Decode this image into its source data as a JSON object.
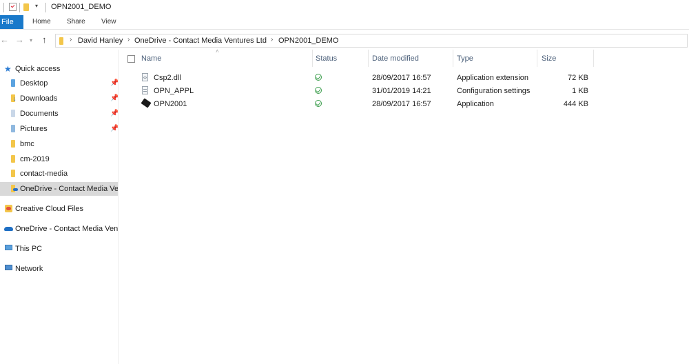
{
  "window": {
    "title": "OPN2001_DEMO"
  },
  "ribbon": {
    "tabs": [
      "File",
      "Home",
      "Share",
      "View"
    ]
  },
  "address": {
    "crumbs": [
      "David Hanley",
      "OneDrive - Contact Media Ventures Ltd",
      "OPN2001_DEMO"
    ]
  },
  "sidebar": {
    "quick_access": "Quick access",
    "items": [
      {
        "label": "Desktop",
        "icon": "desktop-folder-icon",
        "pinned": true
      },
      {
        "label": "Downloads",
        "icon": "downloads-folder-icon",
        "pinned": true
      },
      {
        "label": "Documents",
        "icon": "documents-folder-icon",
        "pinned": true
      },
      {
        "label": "Pictures",
        "icon": "pictures-folder-icon",
        "pinned": true
      },
      {
        "label": "bmc",
        "icon": "folder-icon",
        "pinned": false
      },
      {
        "label": "cm-2019",
        "icon": "folder-icon",
        "pinned": false
      },
      {
        "label": "contact-media",
        "icon": "folder-icon",
        "pinned": false
      },
      {
        "label": "OneDrive - Contact Media Ve",
        "icon": "onedrive-folder-icon",
        "pinned": false
      }
    ],
    "creative_cloud": "Creative Cloud Files",
    "onedrive": "OneDrive - Contact Media Ven",
    "this_pc": "This PC",
    "network": "Network"
  },
  "columns": {
    "name": "Name",
    "status": "Status",
    "date": "Date modified",
    "type": "Type",
    "size": "Size"
  },
  "files": [
    {
      "name": "Csp2.dll",
      "date": "28/09/2017 16:57",
      "type": "Application extension",
      "size": "72 KB",
      "status": "synced"
    },
    {
      "name": "OPN_APPL",
      "date": "31/01/2019 14:21",
      "type": "Configuration settings",
      "size": "1 KB",
      "status": "synced"
    },
    {
      "name": "OPN2001",
      "date": "28/09/2017 16:57",
      "type": "Application",
      "size": "444 KB",
      "status": "synced"
    }
  ],
  "colors": {
    "accent": "#1979ca",
    "folder": "#f3c64a",
    "status_ok": "#3a9d4b",
    "header_text": "#4c607a"
  }
}
